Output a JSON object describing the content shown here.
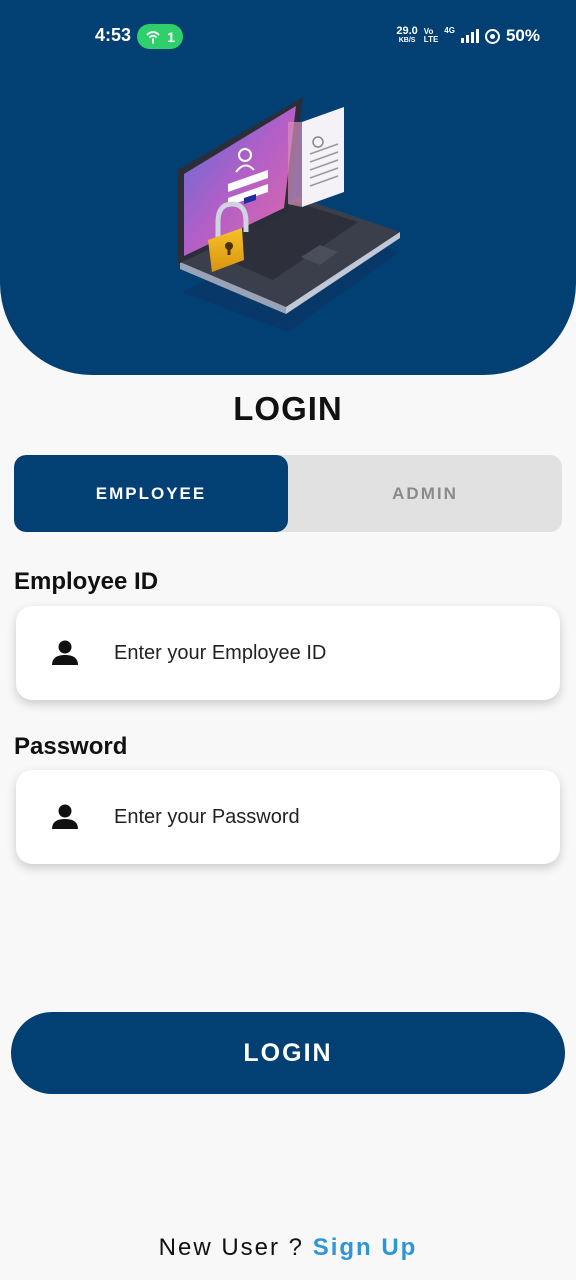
{
  "status_bar": {
    "time": "4:53",
    "hotspot_count": "1",
    "speed_value": "29.0",
    "speed_unit": "KB/S",
    "volte_top": "Vo",
    "volte_bottom": "LTE",
    "network": "4G",
    "battery": "50%"
  },
  "header": {
    "illustration": "laptop-lock-login-illustration"
  },
  "title": "LOGIN",
  "tabs": [
    {
      "label": "EMPLOYEE",
      "active": true
    },
    {
      "label": "ADMIN",
      "active": false
    }
  ],
  "form": {
    "employee_id": {
      "label": "Employee ID",
      "placeholder": "Enter your Employee ID",
      "value": "",
      "icon": "person-icon"
    },
    "password": {
      "label": "Password",
      "placeholder": "Enter your Password",
      "value": "",
      "icon": "person-icon"
    }
  },
  "login_button": "LOGIN",
  "footer": {
    "prompt": "New User ? ",
    "link": "Sign Up"
  },
  "colors": {
    "primary": "#023f73",
    "accent_link": "#2f96d4",
    "tab_inactive_bg": "#e1e1e1",
    "background": "#f8f8f8"
  }
}
